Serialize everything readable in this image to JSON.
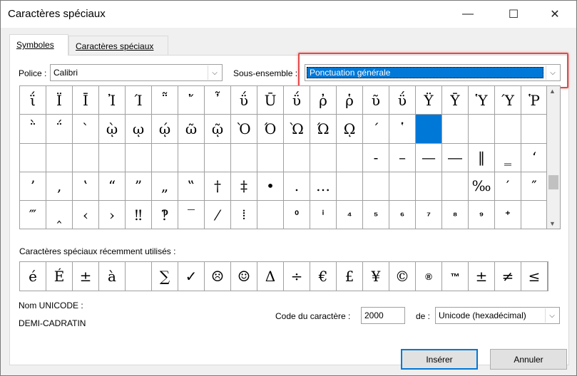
{
  "window": {
    "title": "Caractères spéciaux",
    "minimize_glyph": "—",
    "maximize_glyph": "☐",
    "close_glyph": "✕"
  },
  "tabs": [
    {
      "label": "Symboles",
      "active": true
    },
    {
      "label": "Caractères spéciaux",
      "active": false
    }
  ],
  "font": {
    "label": "Police :",
    "value": "Calibri"
  },
  "subset": {
    "label": "Sous-ensemble :",
    "value": "Ponctuation générale"
  },
  "dropdown_glyph": "⌵",
  "symbols": [
    "ΐ",
    "Ϊ",
    "Ī",
    "Ἰ",
    "Ί",
    "῁",
    "῎",
    "῏",
    "ΰ",
    "Ū",
    "ΰ",
    "ῤ",
    "ῥ",
    "ῦ",
    "ΰ",
    "Ÿ",
    "Ȳ",
    "Ὑ",
    "Ύ",
    "Ῥ",
    "῭",
    "΅",
    "`",
    "ῲ",
    "ῳ",
    "ῴ",
    "ῶ",
    "ῷ",
    "Ὸ",
    "Ό",
    "Ὼ",
    "Ώ",
    "ῼ",
    "´",
    "῾",
    "",
    "",
    "",
    "",
    "",
    "",
    "",
    "",
    "",
    "",
    "",
    "",
    "",
    "",
    "",
    "",
    "",
    "",
    "-",
    "–",
    "—",
    "―",
    "‖",
    "‗",
    "‘",
    "’",
    "‚",
    "‛",
    "“",
    "”",
    "„",
    "‟",
    "†",
    "‡",
    "•",
    "․",
    "…",
    "",
    "",
    "",
    "",
    "",
    "‰",
    "′",
    "″",
    "‴",
    "‸",
    "‹",
    "›",
    "‼",
    "‽",
    "‾",
    "⁄",
    "⁞",
    "",
    "⁰",
    "ⁱ",
    "⁴",
    "⁵",
    "⁶",
    "⁷",
    "⁸",
    "⁹",
    "⁺",
    ""
  ],
  "selected_index": 35,
  "recent_label": "Caractères spéciaux récemment utilisés :",
  "recent": [
    "é",
    "É",
    "±",
    "à",
    "",
    "∑",
    "✓",
    "☹",
    "☺",
    "Δ",
    "÷",
    "€",
    "£",
    "¥",
    "©",
    "®",
    "™",
    "±",
    "≠",
    "≤"
  ],
  "unicode_name": {
    "label": "Nom UNICODE :",
    "value": "DEMI-CADRATIN"
  },
  "char_code": {
    "label": "Code du caractère :",
    "value": "2000"
  },
  "from": {
    "label": "de :",
    "value": "Unicode (hexadécimal)"
  },
  "buttons": {
    "insert": "Insérer",
    "cancel": "Annuler"
  },
  "scroll": {
    "up": "▲",
    "down": "▼"
  },
  "colors": {
    "selection": "#0078d7",
    "highlight": "#e14a4a"
  }
}
